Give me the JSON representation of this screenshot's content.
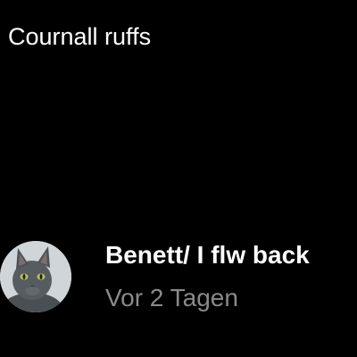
{
  "header": {
    "title": "Cournall ruffs"
  },
  "list": {
    "items": [
      {
        "title": "Benett/ I flw back",
        "subtitle": "Vor 2 Tagen",
        "avatar_icon": "cat-avatar"
      }
    ]
  },
  "colors": {
    "background": "#000000",
    "title_text": "#ffffff",
    "subtitle_text": "#8a8a8a"
  }
}
